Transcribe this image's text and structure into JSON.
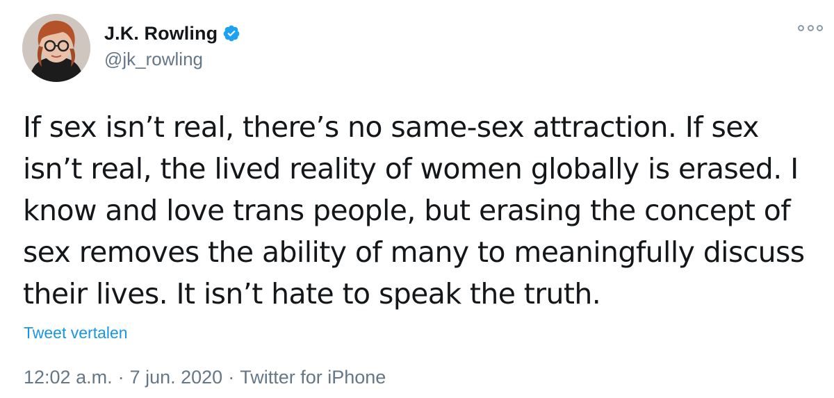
{
  "author": {
    "display_name": "J.K. Rowling",
    "handle": "@jk_rowling",
    "verified": true
  },
  "tweet": {
    "text": "If sex isn’t real, there’s no same-sex attraction. If sex isn’t real, the lived reality of women globally is erased. I know and love trans people, but erasing the concept of sex removes the ability of many to meaningfully discuss their lives. It isn’t hate to speak the truth.",
    "translate_label": "Tweet vertalen",
    "time": "12:02 a.m.",
    "date": "7 jun. 2020",
    "source": "Twitter for iPhone",
    "separator": "·"
  },
  "icons": {
    "more": "more-options-icon",
    "verified": "verified-badge-icon"
  },
  "colors": {
    "text": "#14171a",
    "secondary": "#657786",
    "link": "#1b95e0",
    "verified": "#1da1f2"
  }
}
